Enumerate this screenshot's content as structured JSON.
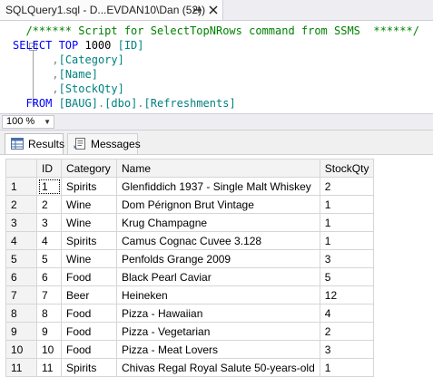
{
  "tab": {
    "title": "SQLQuery1.sql - D...EVDAN10\\Dan (52))",
    "pin_icon": "pin-icon",
    "close_icon": "close-icon"
  },
  "editor": {
    "lines": [
      {
        "indent": "  ",
        "parts": [
          {
            "c": "cm",
            "t": "/****** Script for SelectTopNRows command from SSMS  ******/"
          }
        ]
      },
      {
        "indent": "",
        "parts": [
          {
            "c": "kw",
            "t": "SELECT TOP "
          },
          {
            "c": "",
            "t": "1000 "
          },
          {
            "c": "id",
            "t": "[ID]"
          }
        ]
      },
      {
        "indent": "      ",
        "parts": [
          {
            "c": "op",
            "t": ","
          },
          {
            "c": "id",
            "t": "[Category]"
          }
        ]
      },
      {
        "indent": "      ",
        "parts": [
          {
            "c": "op",
            "t": ","
          },
          {
            "c": "id",
            "t": "[Name]"
          }
        ]
      },
      {
        "indent": "      ",
        "parts": [
          {
            "c": "op",
            "t": ","
          },
          {
            "c": "id",
            "t": "[StockQty]"
          }
        ]
      },
      {
        "indent": "  ",
        "parts": [
          {
            "c": "kw",
            "t": "FROM "
          },
          {
            "c": "id",
            "t": "[BAUG]"
          },
          {
            "c": "op",
            "t": "."
          },
          {
            "c": "id",
            "t": "[dbo]"
          },
          {
            "c": "op",
            "t": "."
          },
          {
            "c": "id",
            "t": "[Refreshments]"
          }
        ]
      }
    ]
  },
  "zoom": {
    "value": "100 %"
  },
  "result_tabs": [
    {
      "label": "Results",
      "icon": "grid-icon",
      "active": true
    },
    {
      "label": "Messages",
      "icon": "messages-icon",
      "active": false
    }
  ],
  "grid": {
    "columns": [
      "",
      "ID",
      "Category",
      "Name",
      "StockQty"
    ],
    "rows": [
      [
        "1",
        "1",
        "Spirits",
        "Glenfiddich 1937 - Single Malt Whiskey",
        "2"
      ],
      [
        "2",
        "2",
        "Wine",
        "Dom Pérignon Brut Vintage",
        "1"
      ],
      [
        "3",
        "3",
        "Wine",
        "Krug Champagne",
        "1"
      ],
      [
        "4",
        "4",
        "Spirits",
        "Camus Cognac Cuvee 3.128",
        "1"
      ],
      [
        "5",
        "5",
        "Wine",
        "Penfolds Grange 2009",
        "3"
      ],
      [
        "6",
        "6",
        "Food",
        "Black Pearl Caviar",
        "5"
      ],
      [
        "7",
        "7",
        "Beer",
        "Heineken",
        "12"
      ],
      [
        "8",
        "8",
        "Food",
        "Pizza - Hawaiian",
        "4"
      ],
      [
        "9",
        "9",
        "Food",
        "Pizza - Vegetarian",
        "2"
      ],
      [
        "10",
        "10",
        "Food",
        "Pizza - Meat Lovers",
        "3"
      ],
      [
        "11",
        "11",
        "Spirits",
        "Chivas Regal Royal Salute 50-years-old",
        "1"
      ]
    ]
  }
}
